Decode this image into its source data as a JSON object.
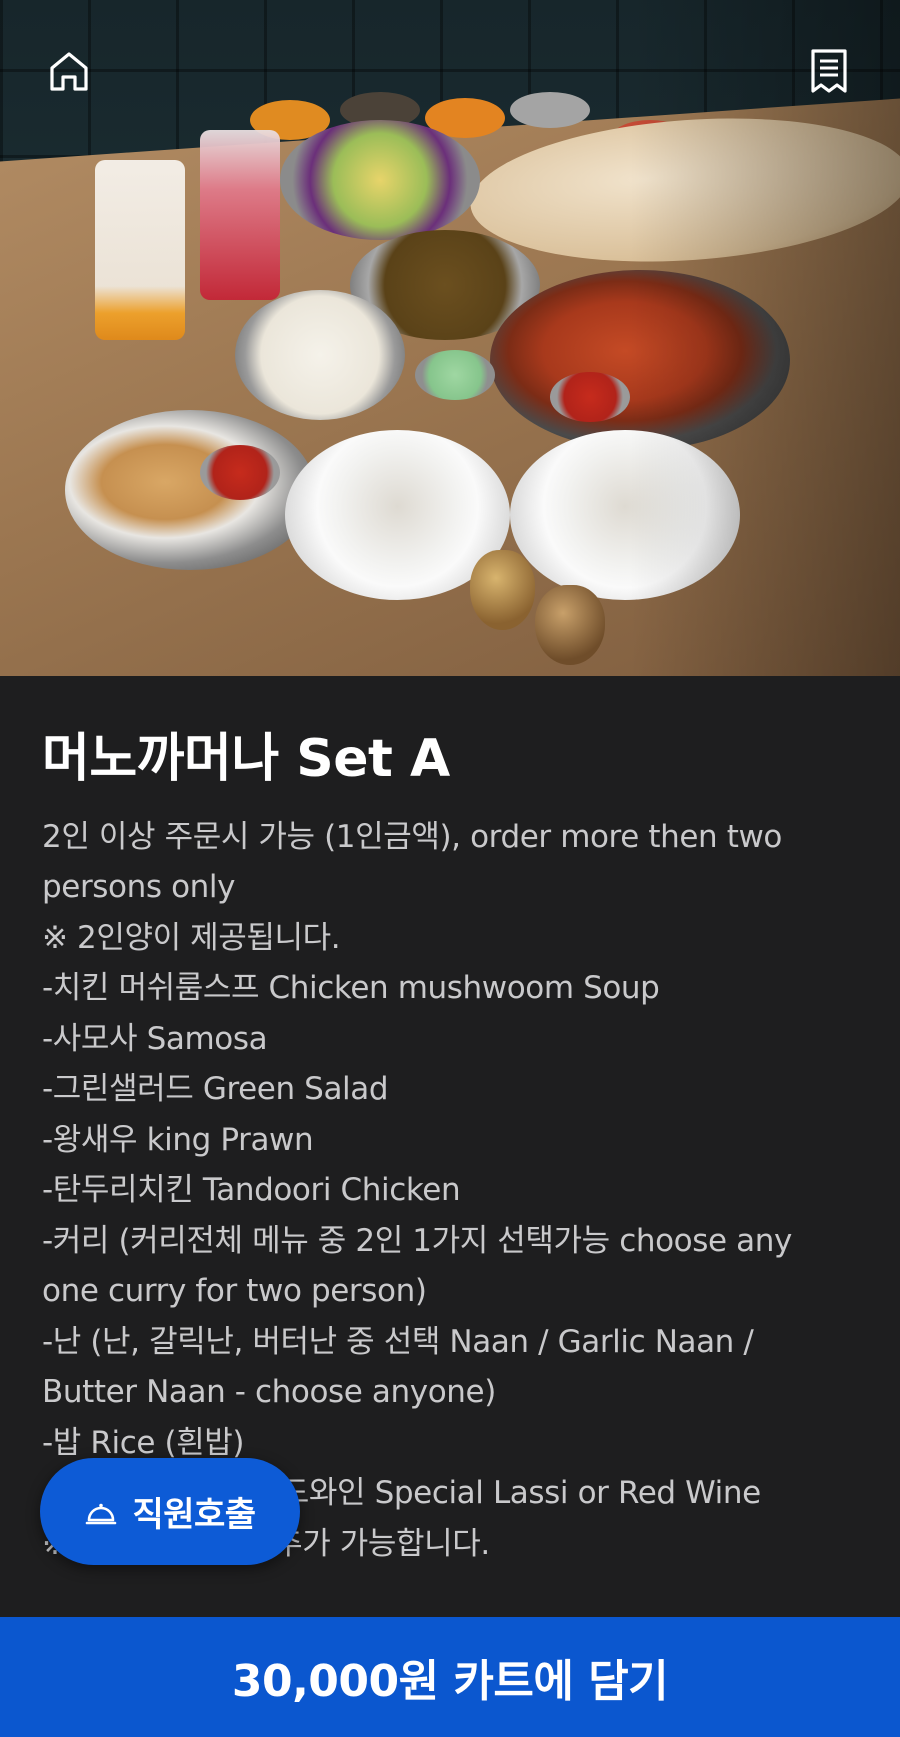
{
  "header": {
    "home_icon": "home-icon",
    "receipt_icon": "receipt-icon"
  },
  "menu": {
    "title": "머노까머나 Set A",
    "description_lines": [
      "2인 이상 주문시 가능 (1인금액), order more then two",
      "persons only",
      "※ 2인양이 제공됩니다.",
      "-치킨 머쉬룸스프 Chicken mushwoom Soup",
      "-사모사 Samosa",
      "-그린샐러드 Green Salad",
      "-왕새우 king Prawn",
      "-탄두리치킨 Tandoori Chicken",
      "-커리 (커리전체 메뉴 중 2인 1가지 선택가능 choose any",
      "one curry for two person)",
      "-난 (난, 갈릭난, 버터난 중 선택 Naan / Garlic Naan /",
      "Butter Naan - choose anyone)",
      "-밥 Rice (흰밥)",
      "-스페셜 라씨 or 레드와인 Special Lassi or Red Wine",
      "※ 음료 변경 교환 추가 가능합니다."
    ]
  },
  "staff_call": {
    "label": "직원호출",
    "icon": "bell-icon"
  },
  "cart": {
    "label": "30,000원 카트에 담기"
  },
  "colors": {
    "background": "#1e1e1f",
    "accent": "#0b57cf",
    "text_primary": "#ffffff",
    "text_secondary": "#c9c9cb"
  }
}
